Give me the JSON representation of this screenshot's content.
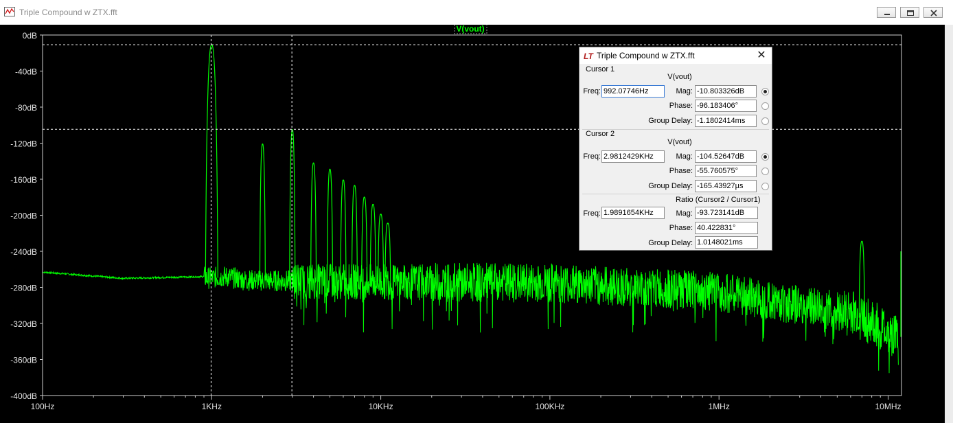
{
  "window": {
    "title": "Triple Compound w ZTX.fft"
  },
  "trace": {
    "label": "V(vout)",
    "color": "#00ff00"
  },
  "chart_data": {
    "type": "line",
    "x_scale": "log",
    "xlim": [
      100,
      12000000
    ],
    "ylim": [
      -400,
      0
    ],
    "x_ticks": [
      {
        "value": 100,
        "label": "100Hz"
      },
      {
        "value": 1000,
        "label": "1KHz"
      },
      {
        "value": 10000,
        "label": "10KHz"
      },
      {
        "value": 100000,
        "label": "100KHz"
      },
      {
        "value": 1000000,
        "label": "1MHz"
      },
      {
        "value": 10000000,
        "label": "10MHz"
      }
    ],
    "y_ticks": [
      {
        "value": 0,
        "label": "0dB"
      },
      {
        "value": -40,
        "label": "-40dB"
      },
      {
        "value": -80,
        "label": "-80dB"
      },
      {
        "value": -120,
        "label": "-120dB"
      },
      {
        "value": -160,
        "label": "-160dB"
      },
      {
        "value": -200,
        "label": "-200dB"
      },
      {
        "value": -240,
        "label": "-240dB"
      },
      {
        "value": -280,
        "label": "-280dB"
      },
      {
        "value": -320,
        "label": "-320dB"
      },
      {
        "value": -360,
        "label": "-360dB"
      },
      {
        "value": -400,
        "label": "-400dB"
      }
    ],
    "noise_floor": [
      [
        100,
        -263
      ],
      [
        300,
        -270
      ],
      [
        900,
        -268
      ],
      [
        930,
        -270
      ],
      [
        1200,
        -268
      ],
      [
        1600,
        -272
      ],
      [
        3000,
        -273
      ],
      [
        10000,
        -274
      ],
      [
        100000,
        -275
      ],
      [
        1000000,
        -285
      ],
      [
        3000000,
        -300
      ],
      [
        5500000,
        -307
      ],
      [
        6500000,
        -310
      ],
      [
        8000000,
        -320
      ],
      [
        11500000,
        -335
      ]
    ],
    "harmonics": [
      {
        "freq": 1000,
        "mag": -11
      },
      {
        "freq": 2000,
        "mag": -121
      },
      {
        "freq": 3000,
        "mag": -105
      },
      {
        "freq": 4000,
        "mag": -142
      },
      {
        "freq": 5000,
        "mag": -149
      },
      {
        "freq": 6000,
        "mag": -161
      },
      {
        "freq": 7000,
        "mag": -167
      },
      {
        "freq": 8000,
        "mag": -180
      },
      {
        "freq": 9000,
        "mag": -188
      },
      {
        "freq": 10000,
        "mag": -199
      },
      {
        "freq": 11000,
        "mag": -209
      },
      {
        "freq": 7000000,
        "mag": -229
      }
    ],
    "cursors": [
      {
        "freq": 992.07746,
        "mag": -10.803326
      },
      {
        "freq": 2981.2429,
        "mag": -104.52647
      }
    ]
  },
  "dialog": {
    "title": "Triple Compound w ZTX.fft",
    "cursor1": {
      "group": "Cursor 1",
      "trace": "V(vout)",
      "freq_label": "Freq:",
      "freq": "992.07746Hz",
      "mag_label": "Mag:",
      "mag": "-10.803326dB",
      "phase_label": "Phase:",
      "phase": "-96.183406°",
      "gd_label": "Group Delay:",
      "group_delay": "-1.1802414ms"
    },
    "cursor2": {
      "group": "Cursor 2",
      "trace": "V(vout)",
      "freq_label": "Freq:",
      "freq": "2.9812429KHz",
      "mag_label": "Mag:",
      "mag": "-104.52647dB",
      "phase_label": "Phase:",
      "phase": "-55.760575°",
      "gd_label": "Group Delay:",
      "group_delay": "-165.43927µs"
    },
    "ratio": {
      "group": "Ratio (Cursor2 / Cursor1)",
      "freq_label": "Freq:",
      "freq": "1.9891654KHz",
      "mag_label": "Mag:",
      "mag": "-93.723141dB",
      "phase_label": "Phase:",
      "phase": "40.422831°",
      "gd_label": "Group Delay:",
      "group_delay": "1.0148021ms"
    }
  }
}
